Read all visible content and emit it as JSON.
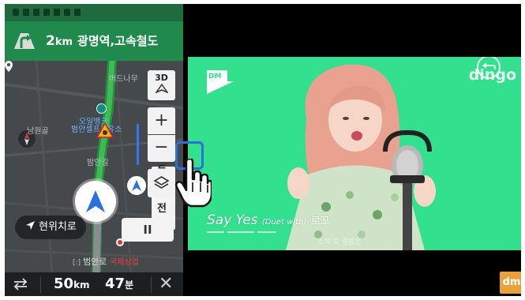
{
  "navigation": {
    "banner": {
      "distance_value": "2",
      "distance_unit": "km",
      "destination": "광명역,고속철도"
    },
    "map": {
      "labels": [
        "버드나무",
        "오일뱅크",
        "범안셀프주유소",
        "남원골",
        "밤안길",
        "범안로",
        "국제상업"
      ],
      "view_mode_label": "3D",
      "zoom_in_label": "+",
      "zoom_out_label": "−",
      "peek_labels": [
        "들",
        "전"
      ],
      "pause_label": "II",
      "recenter_label": "현위치로",
      "bottom_poi_code": "[:]",
      "bottom_poi_name": "범안로",
      "bottom_poi_extra": "국제상업"
    },
    "bottom_bar": {
      "remaining_distance_value": "50",
      "remaining_distance_unit": "km",
      "remaining_time_value": "47",
      "remaining_time_unit": "분",
      "close_label": "✕"
    }
  },
  "video": {
    "channel_logo_text": "DM",
    "watermark": "dingo",
    "caption_title": "Say Yes",
    "caption_duet": "(Duet with)",
    "caption_artist": "로꼬",
    "watermark_kr": "소식 및 앨범은",
    "corner_badge": "dm"
  },
  "colors": {
    "nav_green": "#1f8a4c",
    "video_green": "#32e08e",
    "accent_blue": "#2c7bf0",
    "badge_orange": "#e9a23b"
  }
}
